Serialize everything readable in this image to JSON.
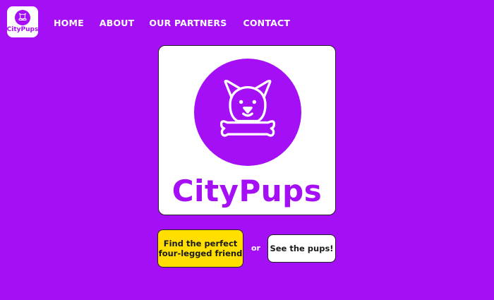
{
  "brand": {
    "name": "CityPups",
    "logo_icon": "dog-with-bone-icon",
    "accent_color": "#a50ff5"
  },
  "nav": {
    "items": [
      {
        "label": "HOME"
      },
      {
        "label": "ABOUT"
      },
      {
        "label": "OUR PARTNERS"
      },
      {
        "label": "CONTACT"
      }
    ]
  },
  "hero": {
    "title": "CityPups",
    "icon": "dog-with-bone-icon"
  },
  "actions": {
    "primary_label_line1": "Find the perfect",
    "primary_label_line2": "four-legged friend",
    "primary_color": "#ffde00",
    "separator": "or",
    "secondary_label": "See the pups!"
  }
}
